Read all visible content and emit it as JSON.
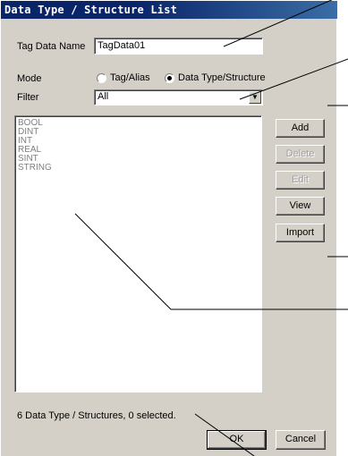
{
  "window": {
    "title": "Data Type / Structure List"
  },
  "tag_data_name": {
    "label": "Tag Data Name",
    "value": "TagData01"
  },
  "mode": {
    "label": "Mode",
    "options": [
      {
        "label": "Tag/Alias",
        "checked": false
      },
      {
        "label": "Data Type/Structure",
        "checked": true
      }
    ]
  },
  "filter": {
    "label": "Filter",
    "value": "All"
  },
  "list": {
    "items": [
      "BOOL",
      "DINT",
      "INT",
      "REAL",
      "SINT",
      "STRING"
    ]
  },
  "buttons": {
    "add": "Add",
    "delete": "Delete",
    "edit": "Edit",
    "view": "View",
    "import": "Import",
    "ok": "OK",
    "cancel": "Cancel"
  },
  "status": {
    "text": "6 Data Type / Structures, 0 selected."
  },
  "icons": {
    "filter_dropdown": "chevron-down-icon"
  }
}
